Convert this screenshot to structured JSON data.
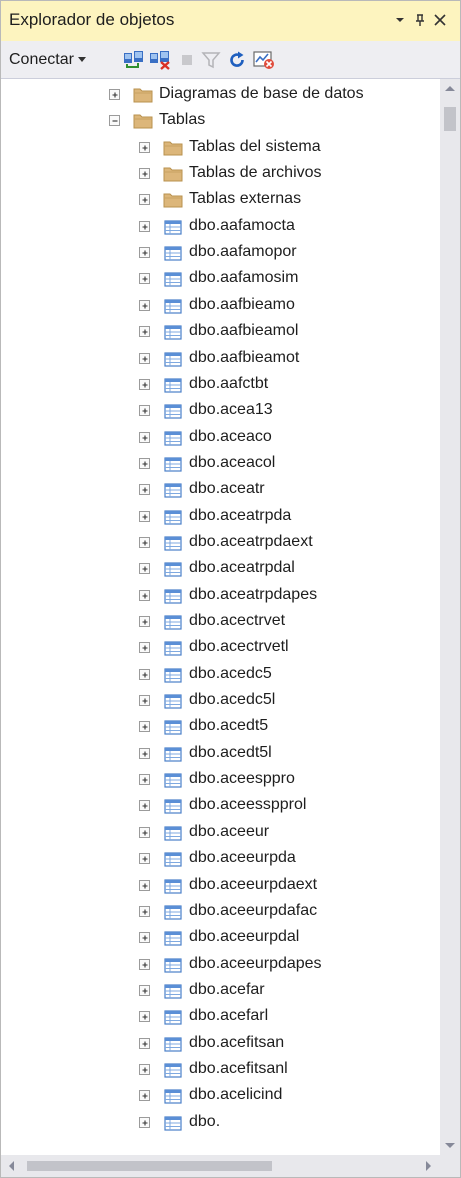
{
  "panel": {
    "title": "Explorador de objetos",
    "buttons": {
      "dropdown": "window-position-dropdown",
      "pin": "pin-icon",
      "close": "close-icon"
    }
  },
  "toolbar": {
    "connect_label": "Conectar",
    "icons": [
      "connect-object-explorer-icon",
      "disconnect-icon",
      "stop-icon",
      "filter-icon",
      "refresh-icon",
      "activity-monitor-icon"
    ]
  },
  "tree": {
    "items": [
      {
        "label": "Diagramas de base de datos",
        "type": "folder",
        "expanded": false,
        "level": 0
      },
      {
        "label": "Tablas",
        "type": "folder",
        "expanded": true,
        "level": 0
      },
      {
        "label": "Tablas del sistema",
        "type": "folder",
        "expanded": false,
        "level": 1
      },
      {
        "label": "Tablas de archivos",
        "type": "folder",
        "expanded": false,
        "level": 1
      },
      {
        "label": "Tablas externas",
        "type": "folder",
        "expanded": false,
        "level": 1
      },
      {
        "label": "dbo.aafamocta",
        "type": "table",
        "expanded": false,
        "level": 1
      },
      {
        "label": "dbo.aafamopor",
        "type": "table",
        "expanded": false,
        "level": 1
      },
      {
        "label": "dbo.aafamosim",
        "type": "table",
        "expanded": false,
        "level": 1
      },
      {
        "label": "dbo.aafbieamo",
        "type": "table",
        "expanded": false,
        "level": 1
      },
      {
        "label": "dbo.aafbieamol",
        "type": "table",
        "expanded": false,
        "level": 1
      },
      {
        "label": "dbo.aafbieamot",
        "type": "table",
        "expanded": false,
        "level": 1
      },
      {
        "label": "dbo.aafctbt",
        "type": "table",
        "expanded": false,
        "level": 1
      },
      {
        "label": "dbo.acea13",
        "type": "table",
        "expanded": false,
        "level": 1
      },
      {
        "label": "dbo.aceaco",
        "type": "table",
        "expanded": false,
        "level": 1
      },
      {
        "label": "dbo.aceacol",
        "type": "table",
        "expanded": false,
        "level": 1
      },
      {
        "label": "dbo.aceatr",
        "type": "table",
        "expanded": false,
        "level": 1
      },
      {
        "label": "dbo.aceatrpda",
        "type": "table",
        "expanded": false,
        "level": 1
      },
      {
        "label": "dbo.aceatrpdaext",
        "type": "table",
        "expanded": false,
        "level": 1
      },
      {
        "label": "dbo.aceatrpdal",
        "type": "table",
        "expanded": false,
        "level": 1
      },
      {
        "label": "dbo.aceatrpdapes",
        "type": "table",
        "expanded": false,
        "level": 1
      },
      {
        "label": "dbo.acectrvet",
        "type": "table",
        "expanded": false,
        "level": 1
      },
      {
        "label": "dbo.acectrvetl",
        "type": "table",
        "expanded": false,
        "level": 1
      },
      {
        "label": "dbo.acedc5",
        "type": "table",
        "expanded": false,
        "level": 1
      },
      {
        "label": "dbo.acedc5l",
        "type": "table",
        "expanded": false,
        "level": 1
      },
      {
        "label": "dbo.acedt5",
        "type": "table",
        "expanded": false,
        "level": 1
      },
      {
        "label": "dbo.acedt5l",
        "type": "table",
        "expanded": false,
        "level": 1
      },
      {
        "label": "dbo.aceesppro",
        "type": "table",
        "expanded": false,
        "level": 1
      },
      {
        "label": "dbo.aceesspprol",
        "type": "table",
        "expanded": false,
        "level": 1
      },
      {
        "label": "dbo.aceeur",
        "type": "table",
        "expanded": false,
        "level": 1
      },
      {
        "label": "dbo.aceeurpda",
        "type": "table",
        "expanded": false,
        "level": 1
      },
      {
        "label": "dbo.aceeurpdaext",
        "type": "table",
        "expanded": false,
        "level": 1
      },
      {
        "label": "dbo.aceeurpdafac",
        "type": "table",
        "expanded": false,
        "level": 1
      },
      {
        "label": "dbo.aceeurpdal",
        "type": "table",
        "expanded": false,
        "level": 1
      },
      {
        "label": "dbo.aceeurpdapes",
        "type": "table",
        "expanded": false,
        "level": 1
      },
      {
        "label": "dbo.acefar",
        "type": "table",
        "expanded": false,
        "level": 1
      },
      {
        "label": "dbo.acefarl",
        "type": "table",
        "expanded": false,
        "level": 1
      },
      {
        "label": "dbo.acefitsan",
        "type": "table",
        "expanded": false,
        "level": 1
      },
      {
        "label": "dbo.acefitsanl",
        "type": "table",
        "expanded": false,
        "level": 1
      },
      {
        "label": "dbo.acelicind",
        "type": "table",
        "expanded": false,
        "level": 1
      },
      {
        "label": "dbo.",
        "type": "table",
        "expanded": false,
        "level": 1
      }
    ]
  },
  "scrollbars": {
    "vertical": {
      "up": "scroll-up-arrow-icon",
      "down": "scroll-down-arrow-icon"
    },
    "horizontal": {
      "left": "scroll-left-arrow-icon",
      "right": "scroll-right-arrow-icon"
    }
  },
  "colors": {
    "title_bar": "#fdf4bf",
    "toolbar": "#eeeef2",
    "folder": "#dcb67a",
    "table_icon": "#5b8fd6"
  }
}
